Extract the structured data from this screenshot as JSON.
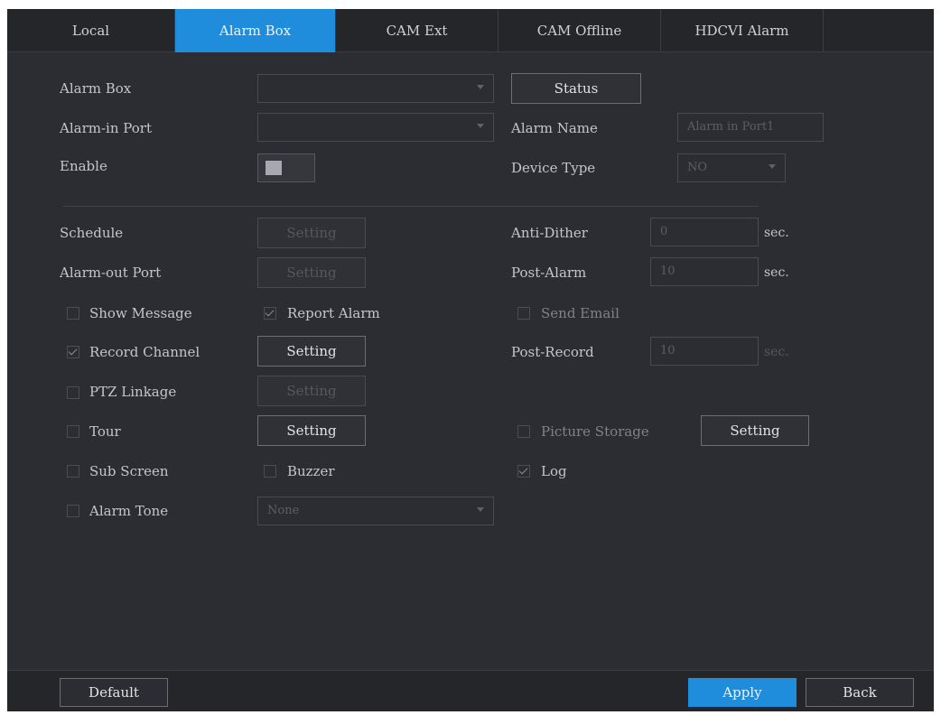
{
  "tabs": [
    "Local",
    "Alarm Box",
    "CAM Ext",
    "CAM Offline",
    "HDCVI Alarm"
  ],
  "active_tab": "Alarm Box",
  "labels": {
    "alarm_box": "Alarm Box",
    "alarm_in_port": "Alarm-in Port",
    "enable": "Enable",
    "alarm_name": "Alarm Name",
    "device_type": "Device Type",
    "schedule": "Schedule",
    "alarm_out_port": "Alarm-out Port",
    "anti_dither": "Anti-Dither",
    "post_alarm": "Post-Alarm",
    "show_message": "Show Message",
    "report_alarm": "Report Alarm",
    "send_email": "Send Email",
    "record_channel": "Record Channel",
    "post_record": "Post-Record",
    "ptz_linkage": "PTZ Linkage",
    "tour": "Tour",
    "picture_storage": "Picture Storage",
    "sub_screen": "Sub Screen",
    "buzzer": "Buzzer",
    "log": "Log",
    "alarm_tone": "Alarm Tone"
  },
  "values": {
    "alarm_name": "Alarm in Port1",
    "device_type": "NO",
    "anti_dither": "0",
    "post_alarm": "10",
    "post_record": "10",
    "alarm_tone": "None"
  },
  "units": {
    "sec": "sec."
  },
  "buttons": {
    "status": "Status",
    "schedule_setting": "Setting",
    "alarm_out_setting": "Setting",
    "record_setting": "Setting",
    "ptz_setting": "Setting",
    "tour_setting": "Setting",
    "picture_setting": "Setting",
    "default": "Default",
    "apply": "Apply",
    "back": "Back"
  },
  "checks": {
    "show_message": false,
    "report_alarm": true,
    "send_email": false,
    "record_channel": true,
    "ptz_linkage": false,
    "tour": false,
    "picture_storage": false,
    "sub_screen": false,
    "buzzer": false,
    "log": true,
    "alarm_tone": false
  },
  "colors": {
    "accent": "#1f8ddb",
    "panel": "#2b2d32"
  }
}
